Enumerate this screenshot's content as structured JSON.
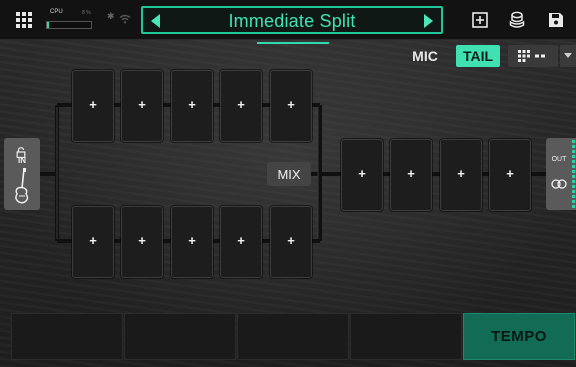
{
  "topbar": {
    "cpu_label": "CPU",
    "cpu_percent": "8 %",
    "cpu_load": 0.05,
    "icons": [
      "grid-icon",
      "bluetooth-icon",
      "wifi-icon",
      "add-block-icon",
      "amp-stack-icon",
      "save-icon"
    ]
  },
  "preset": {
    "name": "Immediate Split"
  },
  "controls": {
    "mic_label": "MIC",
    "tail_label": "TAIL",
    "tail_active": true
  },
  "signal_chain": {
    "input_label": "IN",
    "mix_label": "MIX",
    "output_label": "OUT",
    "top_row": [
      "+",
      "+",
      "+",
      "+",
      "+"
    ],
    "bottom_row": [
      "+",
      "+",
      "+",
      "+",
      "+"
    ],
    "post_mix": [
      "+",
      "+",
      "+",
      "+"
    ]
  },
  "footswitches": {
    "slots": [
      "",
      "",
      "",
      ""
    ],
    "tempo_label": "TEMPO"
  },
  "colors": {
    "accent": "#3fe1b3",
    "tempo_bg": "#126b55",
    "background": "#262626"
  }
}
